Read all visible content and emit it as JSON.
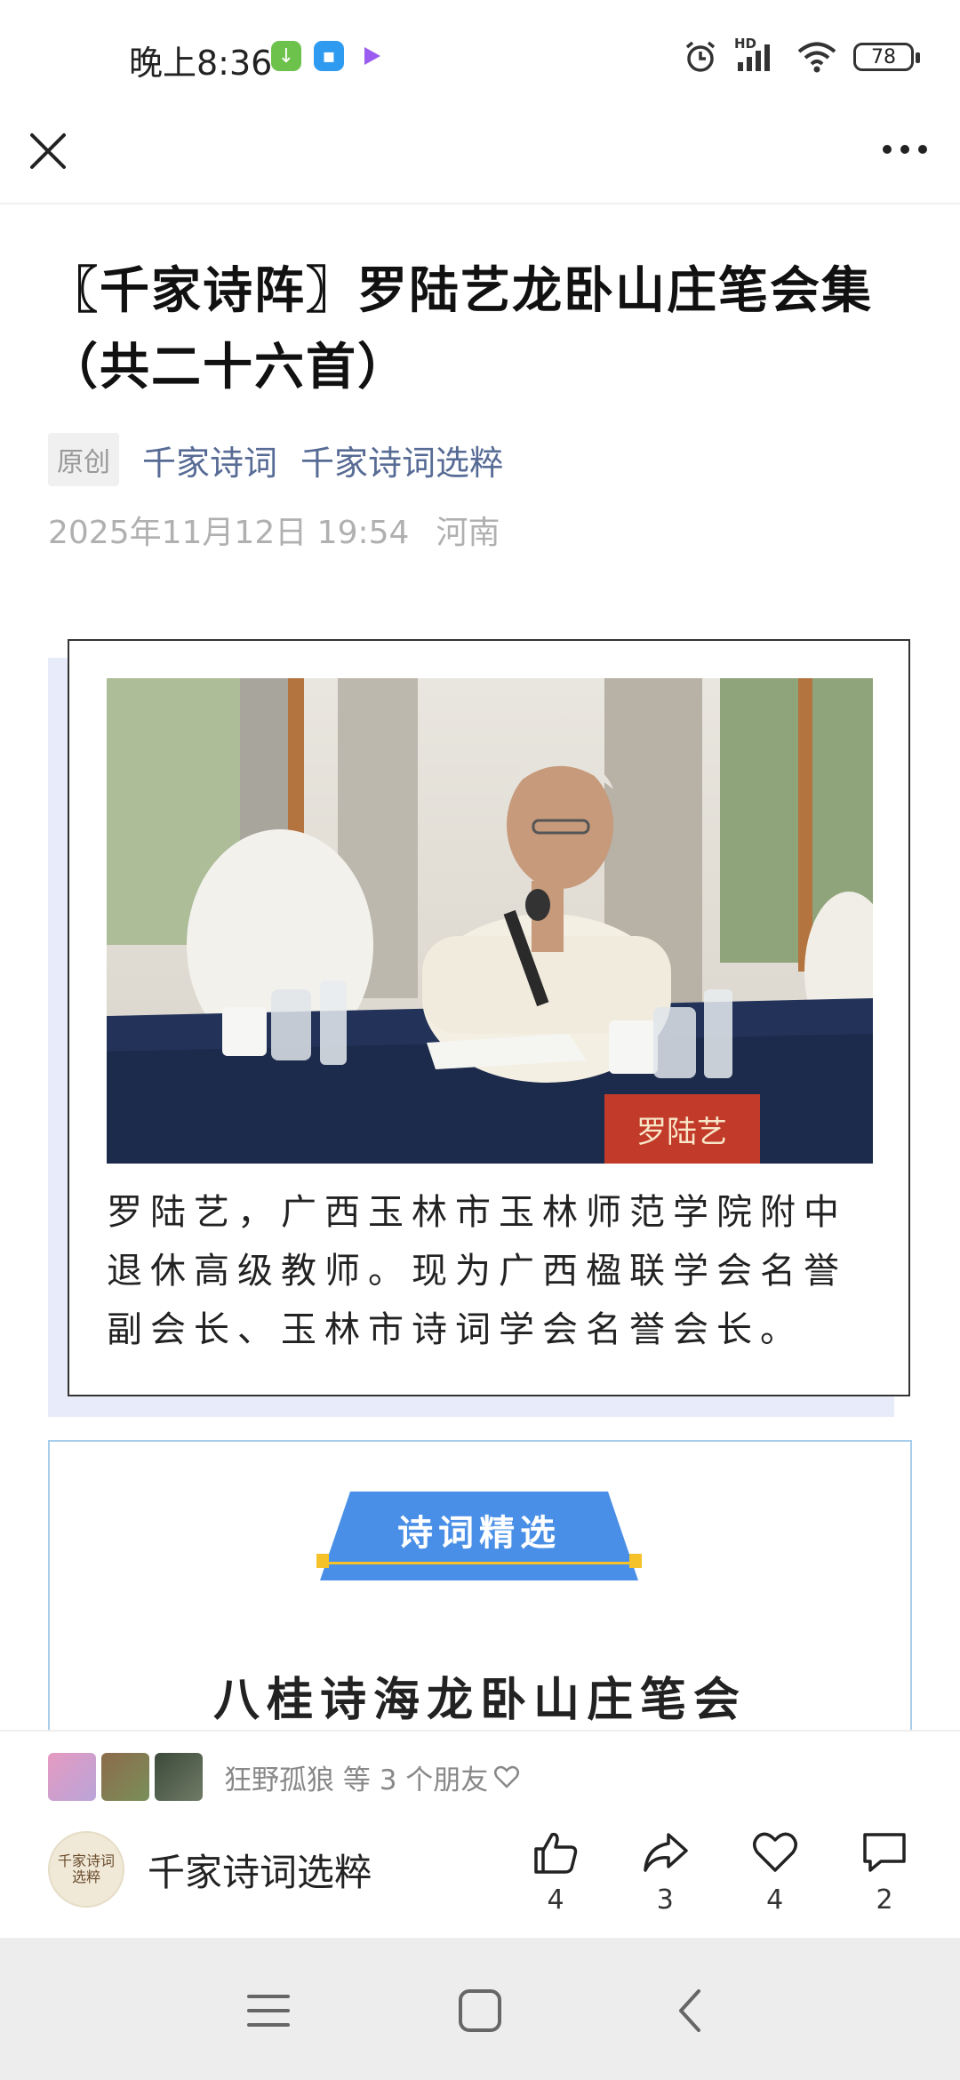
{
  "status_bar": {
    "time": "晚上8:36",
    "battery": "78",
    "network": "HD"
  },
  "article": {
    "title": "〖千家诗阵〗罗陆艺龙卧山庄笔会集（共二十六首）",
    "badge": "原创",
    "links": [
      "千家诗词",
      "千家诗词选粹"
    ],
    "date": "2025年11月12日 19:54",
    "location": "河南"
  },
  "intro_card": {
    "photo_nameplate": "罗陆艺",
    "bio": "罗陆艺，广西玉林市玉林师范学院附中退休高级教师。现为广西楹联学会名誉副会长、玉林市诗词学会名誉会长。"
  },
  "section": {
    "banner_label": "诗词精选",
    "subtitle": "八桂诗海龙卧山庄笔会"
  },
  "bottom_bar": {
    "friends_text": "狂野孤狼 等 3 个朋友",
    "account_name": "千家诗词选粹",
    "account_logo_text": "千家诗词选粹",
    "actions": [
      {
        "icon": "thumbs-up-icon",
        "count": "4"
      },
      {
        "icon": "share-icon",
        "count": "3"
      },
      {
        "icon": "heart-icon",
        "count": "4"
      },
      {
        "icon": "comment-icon",
        "count": "2"
      }
    ]
  },
  "colors": {
    "link": "#576b95",
    "banner": "#4a8fe7",
    "banner_line": "#f5c22a",
    "section_border": "#a8cdea"
  }
}
